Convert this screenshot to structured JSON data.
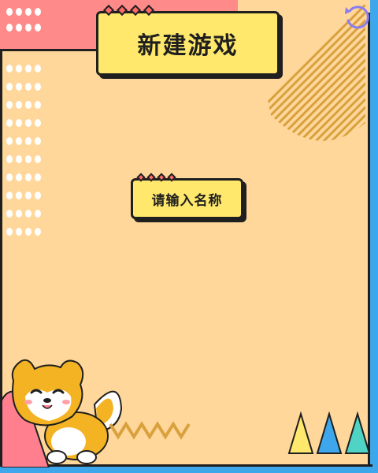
{
  "title": "新建游戏",
  "name_prompt": "请输入名称",
  "icons": {
    "reset": "refresh-icon",
    "mascot": "shiba-dog-icon"
  },
  "colors": {
    "background": "#FFD79A",
    "panel": "#FFE86B",
    "pink": "#FF8A8A",
    "blue": "#3EA6EA",
    "outline": "#1f1f1f",
    "reset_icon": "#8B7CF0"
  }
}
